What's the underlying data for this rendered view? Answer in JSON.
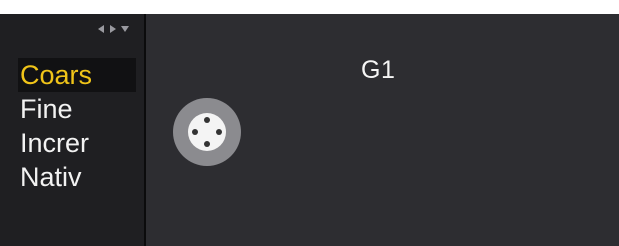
{
  "window": {
    "top_strip_color": "#ffffff",
    "panel_color": "#2d2d31",
    "sidebar_color": "#1f1f22",
    "selected_color": "#f0c419"
  },
  "sidebar": {
    "nav_icons": [
      "left-arrow-icon",
      "right-arrow-icon",
      "down-arrow-icon"
    ],
    "items": [
      {
        "label": "Coars",
        "selected": true
      },
      {
        "label": "Fine",
        "selected": false
      },
      {
        "label": "Increr",
        "selected": false
      },
      {
        "label": "Nativ",
        "selected": false
      }
    ]
  },
  "main": {
    "group_label": "G1",
    "control_icon": "encoder-knob-icon"
  }
}
